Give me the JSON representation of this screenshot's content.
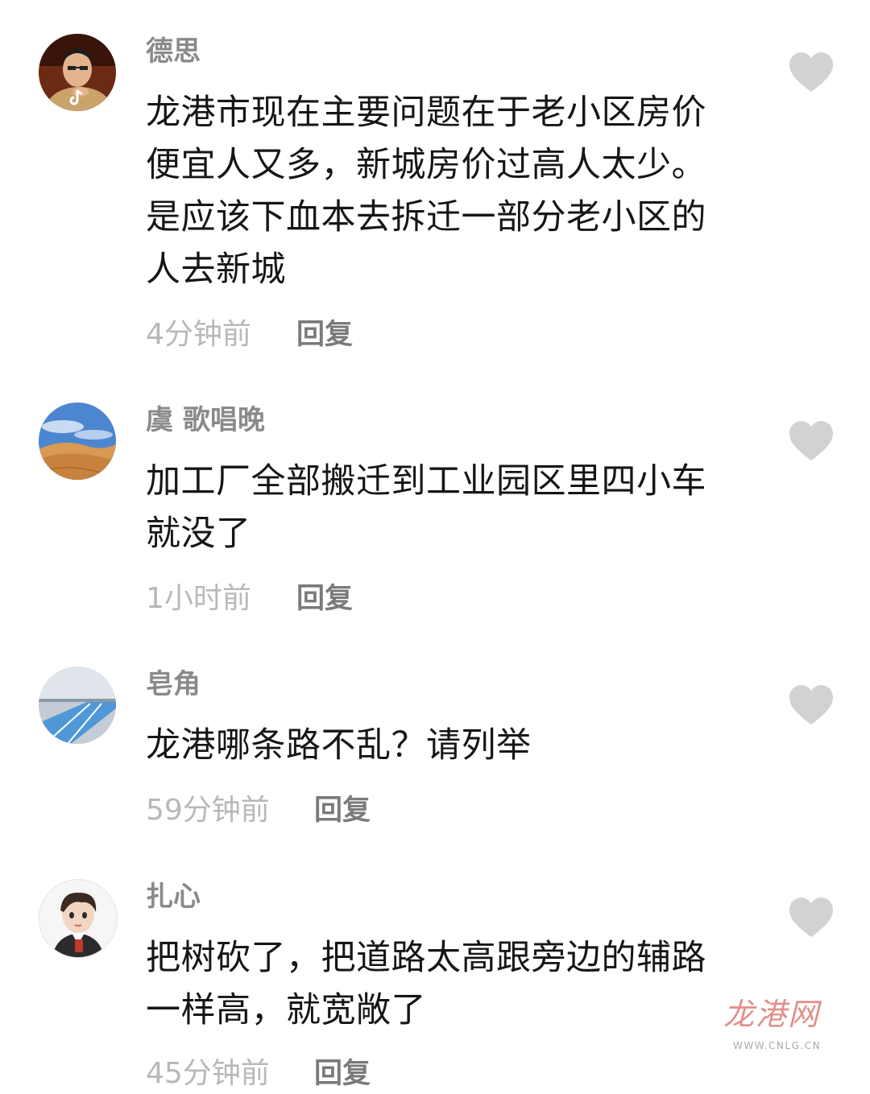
{
  "comments": [
    {
      "username": "德思",
      "text": "龙港市现在主要问题在于老小区房价\n便宜人又多，新城房价过高人太少。\n是应该下血本去拆迁一部分老小区的\n人去新城",
      "time": "4分钟前",
      "reply": "回复",
      "avatar_icon": "portrait-man-icon",
      "badge_icon": "douyin-badge-icon",
      "like_icon": "heart-icon"
    },
    {
      "username": "虞 歌唱晚",
      "text": "加工厂全部搬迁到工业园区里四小车\n就没了",
      "time": "1小时前",
      "reply": "回复",
      "avatar_icon": "desert-landscape-icon",
      "like_icon": "heart-icon"
    },
    {
      "username": "皂角",
      "text": "龙港哪条路不乱？请列举",
      "time": "59分钟前",
      "reply": "回复",
      "avatar_icon": "blue-road-icon",
      "like_icon": "heart-icon"
    },
    {
      "username": "扎心",
      "text": "把树砍了，把道路太高跟旁边的辅路\n一样高，就宽敞了",
      "time": "45分钟前",
      "reply": "回复",
      "avatar_icon": "cartoon-boy-icon",
      "like_icon": "heart-icon"
    }
  ],
  "watermark": {
    "logo_text": "龙港网",
    "url": "WWW.CNLG.CN"
  },
  "colors": {
    "username": "#8a8a8a",
    "text": "#161616",
    "time": "#b8b8b8",
    "reply": "#7a7a7a",
    "heart": "#d2d2d2",
    "watermark": "#e0908a"
  }
}
